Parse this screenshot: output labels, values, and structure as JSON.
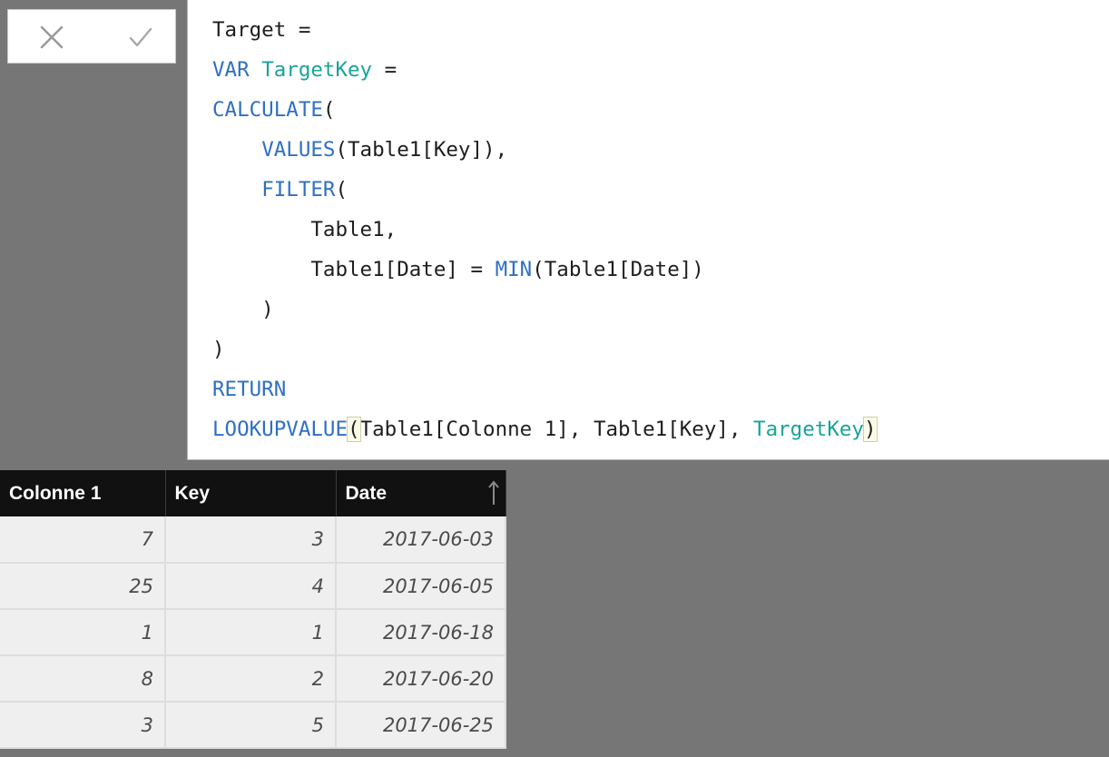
{
  "formula_bar": {
    "cancel_icon": "x-icon",
    "commit_icon": "check-icon",
    "lines": [
      [
        {
          "t": "Target =",
          "c": "plain"
        }
      ],
      [
        {
          "t": "VAR",
          "c": "kw"
        },
        {
          "t": " ",
          "c": "plain"
        },
        {
          "t": "TargetKey",
          "c": "var"
        },
        {
          "t": " =",
          "c": "plain"
        }
      ],
      [
        {
          "t": "CALCULATE",
          "c": "kw"
        },
        {
          "t": "(",
          "c": "plain"
        }
      ],
      [
        {
          "t": "    ",
          "c": "plain"
        },
        {
          "t": "VALUES",
          "c": "kw"
        },
        {
          "t": "(Table1[Key]),",
          "c": "plain"
        }
      ],
      [
        {
          "t": "    ",
          "c": "plain"
        },
        {
          "t": "FILTER",
          "c": "kw"
        },
        {
          "t": "(",
          "c": "plain"
        }
      ],
      [
        {
          "t": "        Table1,",
          "c": "plain"
        }
      ],
      [
        {
          "t": "        Table1[Date] = ",
          "c": "plain"
        },
        {
          "t": "MIN",
          "c": "kw"
        },
        {
          "t": "(Table1[Date])",
          "c": "plain"
        }
      ],
      [
        {
          "t": "    )",
          "c": "plain"
        }
      ],
      [
        {
          "t": ")",
          "c": "plain"
        }
      ],
      [
        {
          "t": "RETURN",
          "c": "kw"
        }
      ],
      [
        {
          "t": "LOOKUPVALUE",
          "c": "kw"
        },
        {
          "t": "(",
          "c": "bm"
        },
        {
          "t": "Table1[Colonne 1], Table1[Key], ",
          "c": "plain"
        },
        {
          "t": "TargetKey",
          "c": "var"
        },
        {
          "t": ")",
          "c": "bm"
        }
      ]
    ]
  },
  "table": {
    "columns": [
      "Colonne 1",
      "Key",
      "Date"
    ],
    "sort_icon": "sort-ascending-arrow-icon",
    "rows": [
      [
        "7",
        "3",
        "2017-06-03"
      ],
      [
        "25",
        "4",
        "2017-06-05"
      ],
      [
        "1",
        "1",
        "2017-06-18"
      ],
      [
        "8",
        "2",
        "2017-06-20"
      ],
      [
        "3",
        "5",
        "2017-06-25"
      ]
    ]
  },
  "colors": {
    "background": "#767676",
    "keyword": "#2f6fc4",
    "variable": "#17a49a",
    "header_bg": "#111111",
    "cell_bg": "#efefef"
  }
}
